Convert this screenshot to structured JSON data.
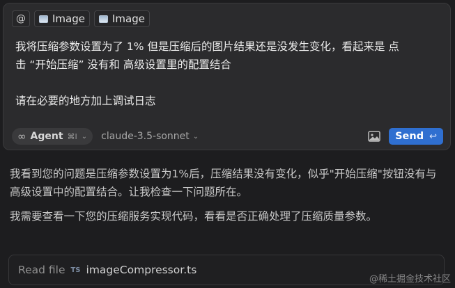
{
  "composer": {
    "context_chips": [
      {
        "label": "@",
        "icon": "at-icon"
      },
      {
        "label": "Image",
        "icon": "image-icon"
      },
      {
        "label": "Image",
        "icon": "image-icon"
      }
    ],
    "prompt_lines": [
      "我将压缩参数设置为了 1% 但是压缩后的图片结果还是没发生变化，看起来是 点",
      "击 “开始压缩” 没有和 高级设置里的配置结合",
      "请在必要的地方加上调试日志"
    ],
    "mode": {
      "icon": "infinity-icon",
      "label": "Agent",
      "shortcut": "⌘I"
    },
    "model": "claude-3.5-sonnet",
    "send": {
      "label": "Send",
      "shortcut_icon": "enter-icon"
    },
    "colors": {
      "send_bg": "#2f6fd0"
    }
  },
  "reply": {
    "paragraph1": "我看到您的问题是压缩参数设置为1%后，压缩结果没有变化，似乎\"开始压缩\"按钮没有与高级设置中的配置结合。让我检查一下问题所在。",
    "paragraph2": "我需要查看一下您的压缩服务实现代码，看看是否正确处理了压缩质量参数。"
  },
  "tool_call": {
    "verb": "Read file",
    "file_badge": "TS",
    "filename": "imageCompressor.ts"
  },
  "watermark": "@稀土掘金技术社区"
}
